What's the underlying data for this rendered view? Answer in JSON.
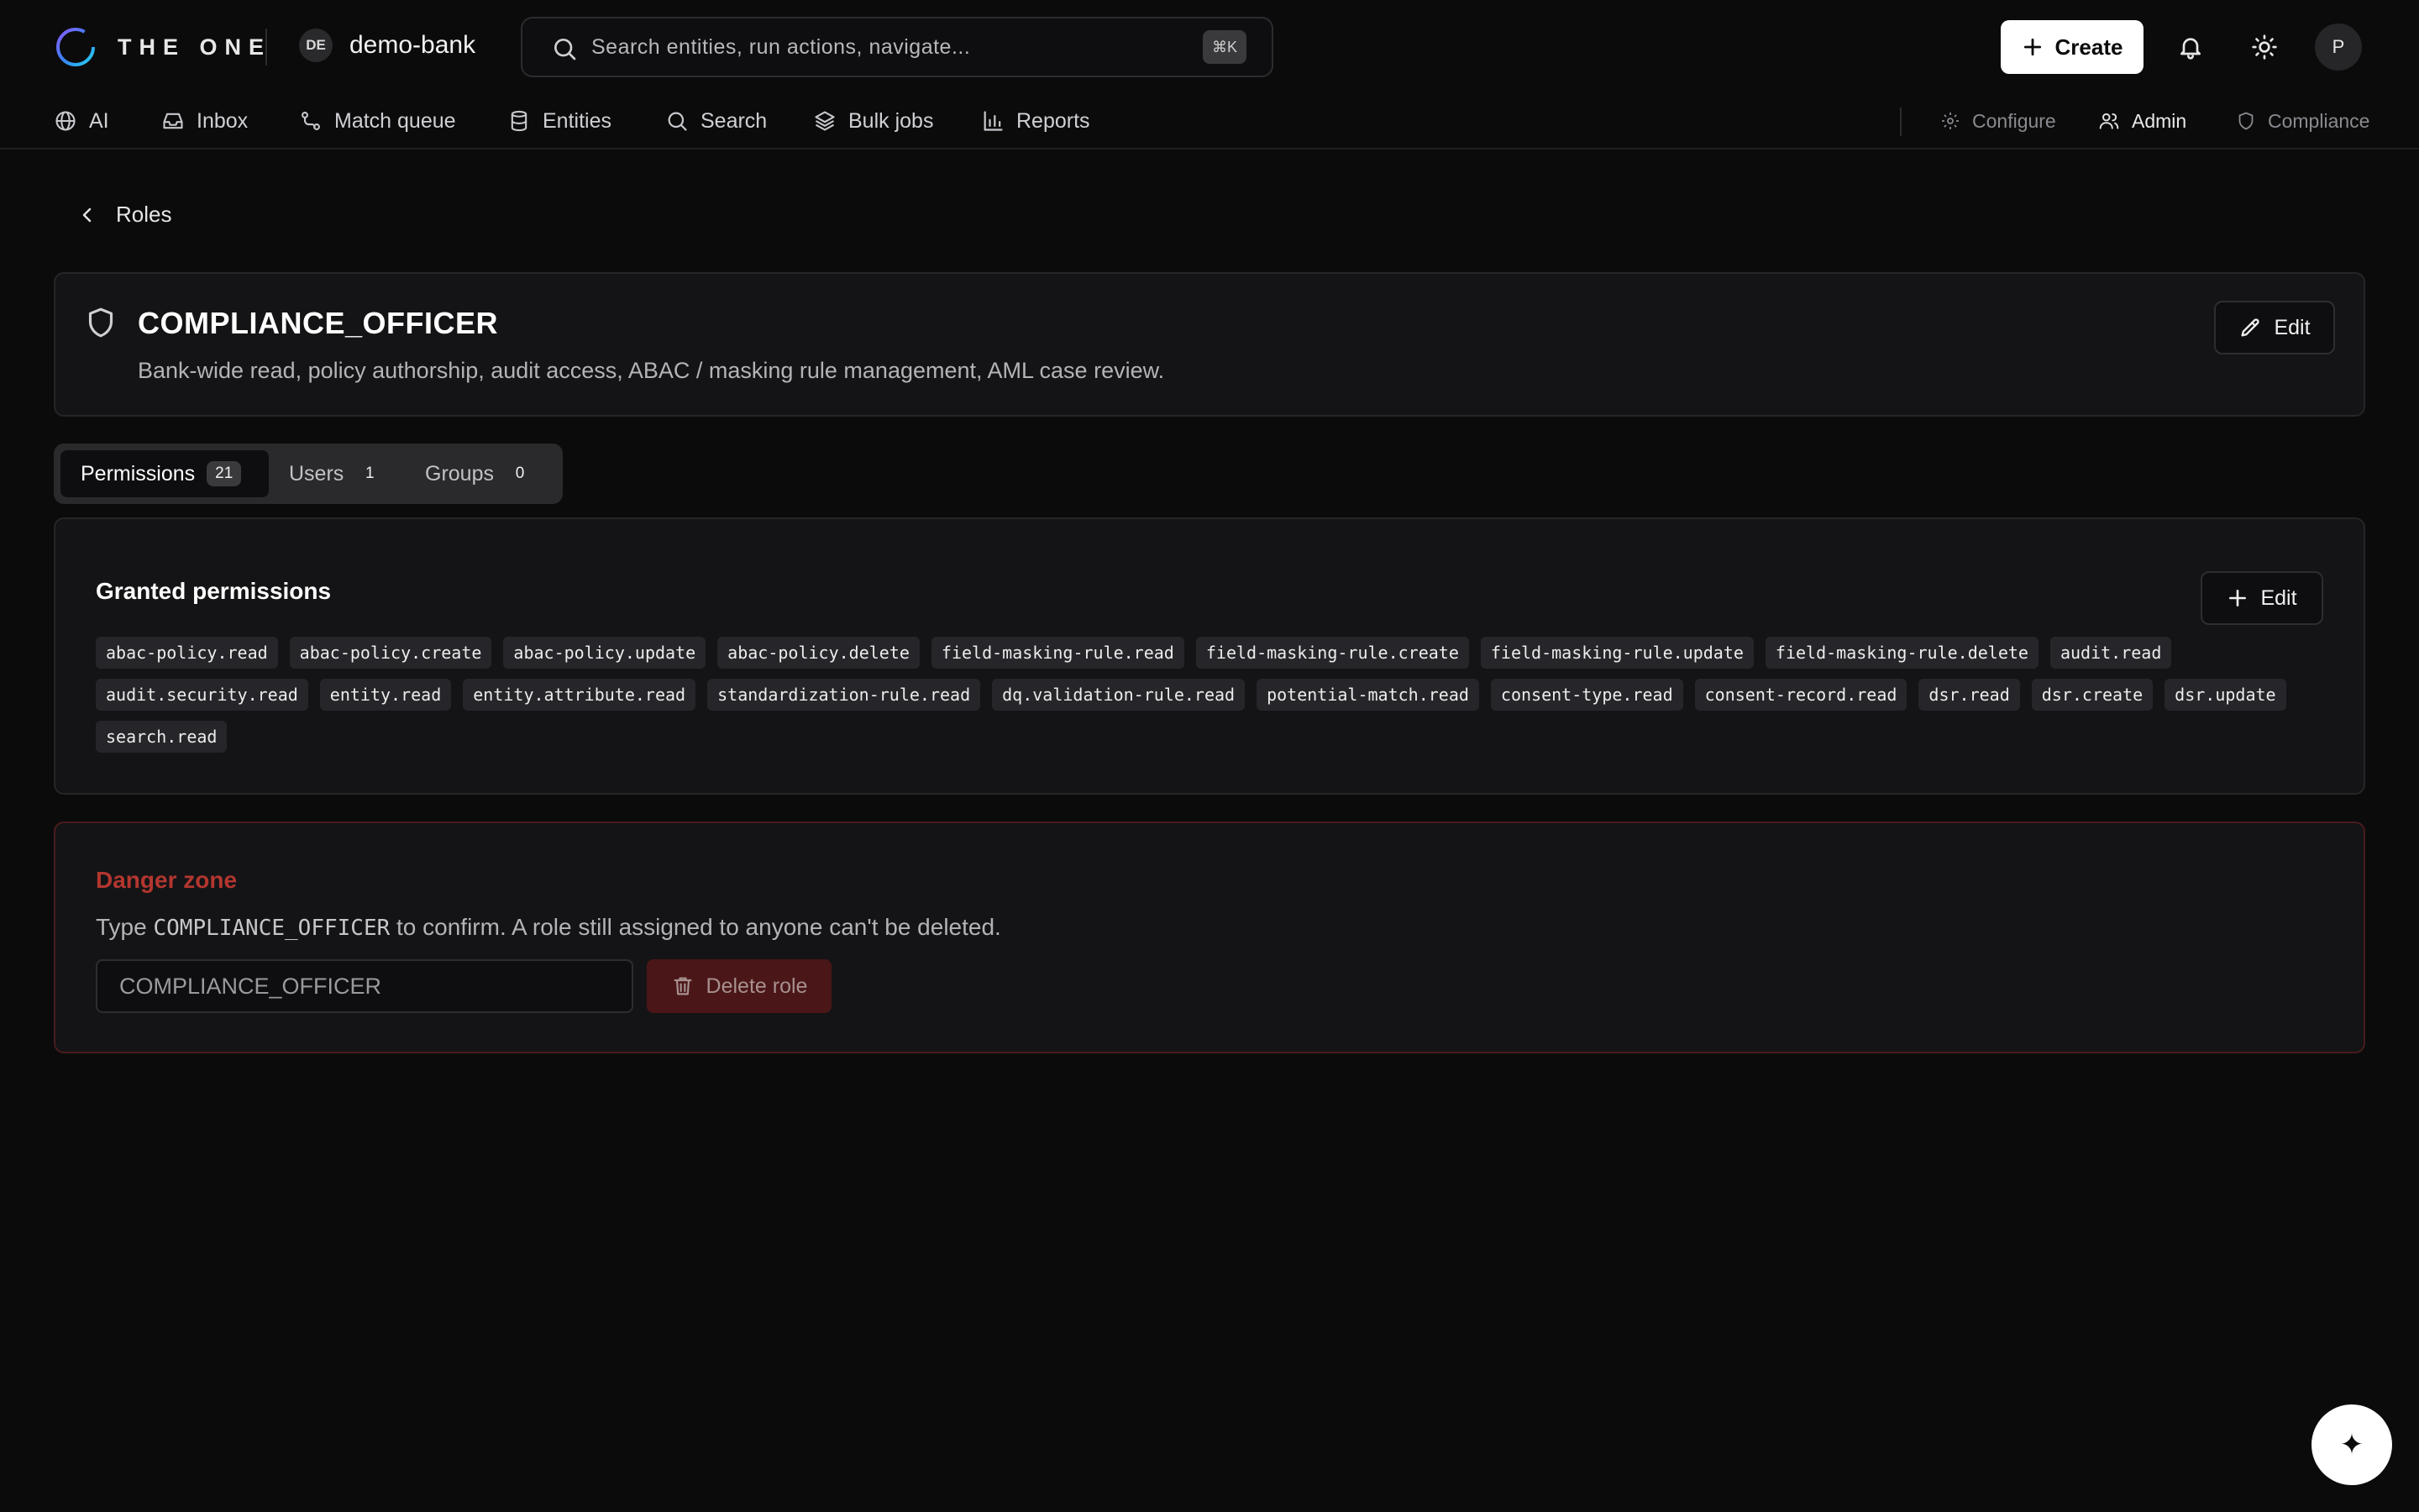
{
  "brand": {
    "name": "THE ONE"
  },
  "tenant": {
    "badge": "DE",
    "name": "demo-bank"
  },
  "search": {
    "placeholder": "Search entities, run actions, navigate...",
    "shortcut": "⌘K"
  },
  "header": {
    "create_label": "Create",
    "avatar": "P"
  },
  "nav": {
    "items": [
      {
        "label": "AI",
        "icon": "globe-icon"
      },
      {
        "label": "Inbox",
        "icon": "inbox-icon"
      },
      {
        "label": "Match queue",
        "icon": "route-icon"
      },
      {
        "label": "Entities",
        "icon": "database-icon"
      },
      {
        "label": "Search",
        "icon": "search-icon"
      },
      {
        "label": "Bulk jobs",
        "icon": "layers-icon"
      },
      {
        "label": "Reports",
        "icon": "bar-chart-icon"
      }
    ],
    "right": [
      {
        "label": "Configure",
        "icon": "gear-icon",
        "active": false
      },
      {
        "label": "Admin",
        "icon": "users-icon",
        "active": true
      },
      {
        "label": "Compliance",
        "icon": "shield-icon",
        "active": false
      }
    ]
  },
  "breadcrumb": {
    "back_label": "Roles"
  },
  "role": {
    "name": "COMPLIANCE_OFFICER",
    "description": "Bank-wide read, policy authorship, audit access, ABAC / masking rule management, AML case review.",
    "edit_label": "Edit"
  },
  "tabs": [
    {
      "label": "Permissions",
      "count": "21",
      "active": true
    },
    {
      "label": "Users",
      "count": "1",
      "active": false
    },
    {
      "label": "Groups",
      "count": "0",
      "active": false
    }
  ],
  "permissions": {
    "title": "Granted permissions",
    "edit_label": "Edit",
    "items": [
      "abac-policy.read",
      "abac-policy.create",
      "abac-policy.update",
      "abac-policy.delete",
      "field-masking-rule.read",
      "field-masking-rule.create",
      "field-masking-rule.update",
      "field-masking-rule.delete",
      "audit.read",
      "audit.security.read",
      "entity.read",
      "entity.attribute.read",
      "standardization-rule.read",
      "dq.validation-rule.read",
      "potential-match.read",
      "consent-type.read",
      "consent-record.read",
      "dsr.read",
      "dsr.create",
      "dsr.update",
      "search.read"
    ]
  },
  "danger": {
    "title": "Danger zone",
    "text_before": "Type ",
    "text_code": "COMPLIANCE_OFFICER",
    "text_after": " to confirm. A role still assigned to anyone can't be deleted.",
    "input_value": "COMPLIANCE_OFFICER",
    "delete_label": "Delete role"
  },
  "fab": {
    "glyph": "✦"
  },
  "colors": {
    "background": "#0b0b0c",
    "card": "#141416",
    "danger": "#b3362f",
    "danger_button": "#4a1618"
  }
}
